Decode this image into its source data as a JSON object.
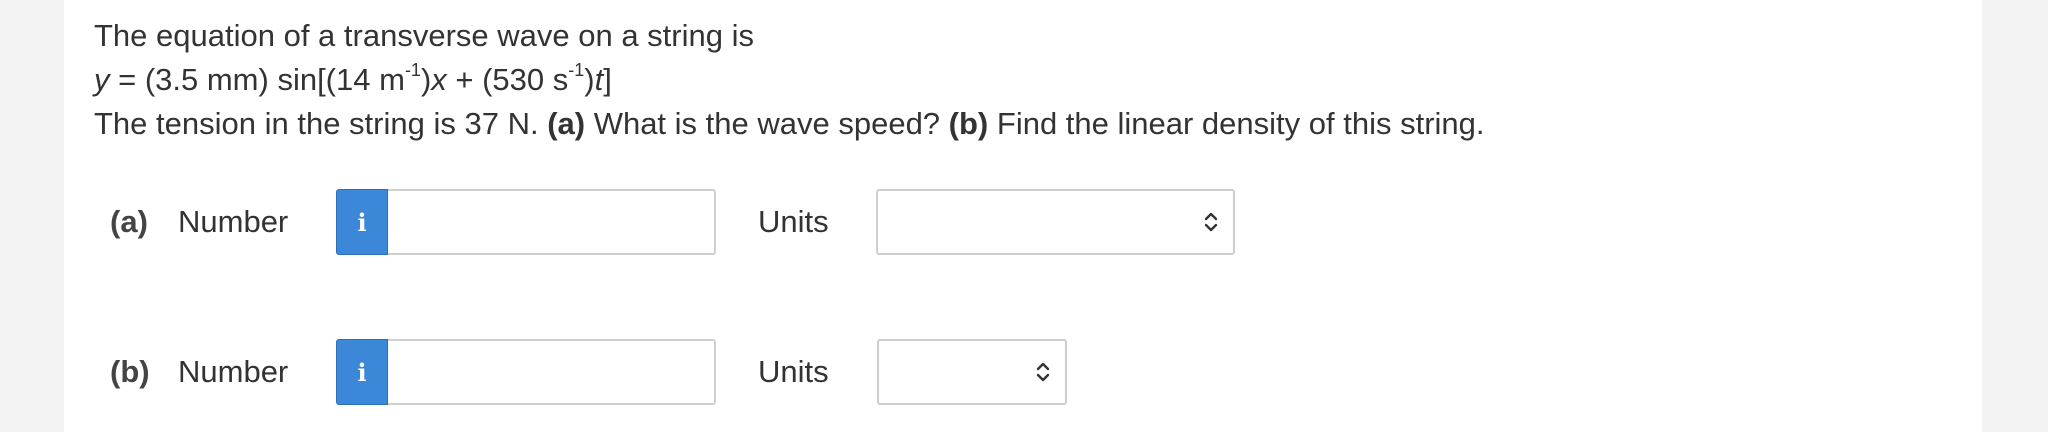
{
  "question": {
    "line1": "The equation of a transverse wave on a string is",
    "equation": {
      "y": "y",
      "eq_part1": " = (3.5 mm) sin[(14 m",
      "exp1": "-1",
      "eq_part2": ")",
      "x": "x",
      "eq_part3": " + (530 s",
      "exp2": "-1",
      "eq_part4": ")",
      "t": "t",
      "eq_part5": "]"
    },
    "line3": {
      "intro": "The tension in the string is 37 N. ",
      "a_label": "(a)",
      "a_text": " What is the wave speed? ",
      "b_label": "(b)",
      "b_text": " Find the linear density of this string."
    }
  },
  "parts": [
    {
      "label": "(a)",
      "number_label": "Number",
      "info_icon": "info-icon",
      "number_value": "",
      "units_label": "Units",
      "units_selected": ""
    },
    {
      "label": "(b)",
      "number_label": "Number",
      "info_icon": "info-icon",
      "number_value": "",
      "units_label": "Units",
      "units_selected": ""
    }
  ],
  "colors": {
    "info_button": "#3b87d8",
    "background": "#f3f3f3",
    "panel": "#ffffff",
    "text": "#333333"
  }
}
